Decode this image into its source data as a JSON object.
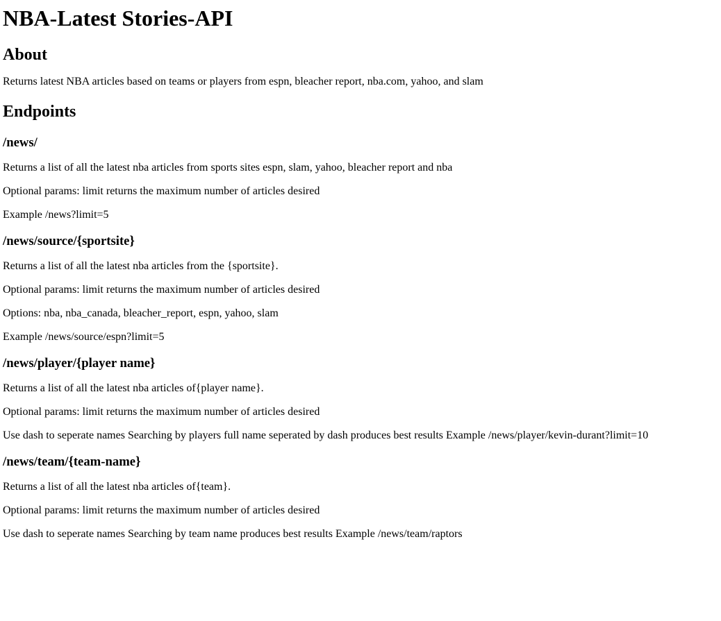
{
  "page": {
    "title": "NBA-Latest Stories-API"
  },
  "about": {
    "heading": "About",
    "text": "Returns latest NBA articles based on teams or players from espn, bleacher report, nba.com, yahoo, and slam"
  },
  "endpoints": {
    "heading": "Endpoints",
    "items": [
      {
        "path": "/news/",
        "lines": [
          "Returns a list of all the latest nba articles from sports sites espn, slam, yahoo, bleacher report and nba",
          "Optional params: limit returns the maximum number of articles desired",
          "Example /news?limit=5"
        ]
      },
      {
        "path": "/news/source/{sportsite}",
        "lines": [
          "Returns a list of all the latest nba articles from the {sportsite}.",
          "Optional params: limit returns the maximum number of articles desired",
          "Options: nba, nba_canada, bleacher_report, espn, yahoo, slam",
          "Example /news/source/espn?limit=5"
        ]
      },
      {
        "path": "/news/player/{player name}",
        "lines": [
          "Returns a list of all the latest nba articles of{player name}.",
          "Optional params: limit returns the maximum number of articles desired",
          "Use dash to seperate names Searching by players full name seperated by dash produces best results Example /news/player/kevin-durant?limit=10"
        ]
      },
      {
        "path": "/news/team/{team-name}",
        "lines": [
          "Returns a list of all the latest nba articles of{team}.",
          "Optional params: limit returns the maximum number of articles desired",
          "Use dash to seperate names Searching by team name produces best results Example /news/team/raptors"
        ]
      }
    ]
  }
}
